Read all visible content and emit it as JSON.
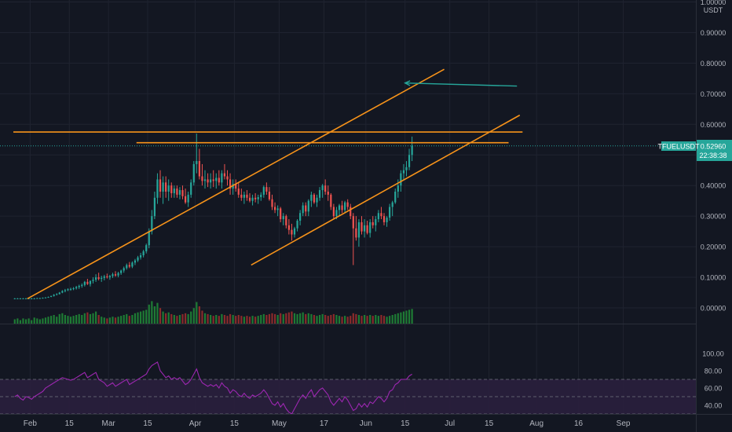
{
  "symbol": "TFUELUSDT",
  "currency": "USDT",
  "last_price": "0.52960",
  "countdown": "22:38:38",
  "colors": {
    "background": "#131722",
    "grid": "#1f2330",
    "up": "#26a69a",
    "down": "#ef5350",
    "vol_up": "#1e7b34",
    "vol_down": "#8a2b2b",
    "trendline": "#f7931a",
    "arrow": "#26a69a",
    "rsi_line": "#9c27b0",
    "rsi_band": "#2a1f3d",
    "price_badge": "#26a69a",
    "axis_text": "#b2b5be"
  },
  "price_axis": {
    "labels": [
      "1.00000",
      "0.90000",
      "0.80000",
      "0.70000",
      "0.60000",
      "0.40000",
      "0.30000",
      "0.20000",
      "0.10000",
      "0.00000"
    ]
  },
  "rsi_axis": {
    "labels": [
      "100.00",
      "80.00",
      "60.00",
      "40.00"
    ]
  },
  "time_axis": {
    "labels": [
      "Feb",
      "15",
      "Mar",
      "15",
      "Apr",
      "15",
      "May",
      "17",
      "Jun",
      "15",
      "Jul",
      "15",
      "Aug",
      "16",
      "Sep"
    ]
  },
  "chart_data": [
    {
      "type": "candlestick",
      "title": "TFUELUSDT",
      "ylabel": "USDT",
      "x_range": [
        "2021-01-26",
        "2021-09-16"
      ],
      "ylim": [
        -0.02,
        1.0
      ],
      "date_start": "2021-01-26",
      "candles": [
        [
          0.031,
          0.032,
          0.029,
          0.031
        ],
        [
          0.031,
          0.032,
          0.03,
          0.031
        ],
        [
          0.031,
          0.032,
          0.03,
          0.031
        ],
        [
          0.031,
          0.032,
          0.03,
          0.031
        ],
        [
          0.031,
          0.032,
          0.03,
          0.031
        ],
        [
          0.031,
          0.032,
          0.03,
          0.031
        ],
        [
          0.031,
          0.032,
          0.03,
          0.031
        ],
        [
          0.031,
          0.032,
          0.03,
          0.031
        ],
        [
          0.031,
          0.033,
          0.03,
          0.032
        ],
        [
          0.032,
          0.033,
          0.031,
          0.032
        ],
        [
          0.032,
          0.034,
          0.031,
          0.033
        ],
        [
          0.033,
          0.035,
          0.032,
          0.034
        ],
        [
          0.034,
          0.037,
          0.033,
          0.036
        ],
        [
          0.036,
          0.04,
          0.035,
          0.039
        ],
        [
          0.039,
          0.045,
          0.037,
          0.043
        ],
        [
          0.043,
          0.048,
          0.041,
          0.045
        ],
        [
          0.045,
          0.052,
          0.044,
          0.05
        ],
        [
          0.05,
          0.058,
          0.048,
          0.055
        ],
        [
          0.055,
          0.062,
          0.051,
          0.058
        ],
        [
          0.058,
          0.064,
          0.055,
          0.061
        ],
        [
          0.061,
          0.066,
          0.056,
          0.062
        ],
        [
          0.062,
          0.068,
          0.058,
          0.064
        ],
        [
          0.064,
          0.072,
          0.06,
          0.068
        ],
        [
          0.068,
          0.076,
          0.062,
          0.072
        ],
        [
          0.072,
          0.08,
          0.066,
          0.075
        ],
        [
          0.075,
          0.088,
          0.07,
          0.085
        ],
        [
          0.085,
          0.095,
          0.075,
          0.078
        ],
        [
          0.078,
          0.09,
          0.07,
          0.088
        ],
        [
          0.088,
          0.1,
          0.08,
          0.092
        ],
        [
          0.092,
          0.11,
          0.085,
          0.1
        ],
        [
          0.1,
          0.115,
          0.09,
          0.095
        ],
        [
          0.095,
          0.105,
          0.085,
          0.098
        ],
        [
          0.098,
          0.108,
          0.09,
          0.103
        ],
        [
          0.103,
          0.112,
          0.096,
          0.1
        ],
        [
          0.1,
          0.108,
          0.092,
          0.104
        ],
        [
          0.104,
          0.115,
          0.098,
          0.11
        ],
        [
          0.11,
          0.12,
          0.102,
          0.106
        ],
        [
          0.106,
          0.118,
          0.1,
          0.114
        ],
        [
          0.114,
          0.125,
          0.108,
          0.122
        ],
        [
          0.122,
          0.135,
          0.115,
          0.13
        ],
        [
          0.13,
          0.145,
          0.125,
          0.14
        ],
        [
          0.14,
          0.15,
          0.13,
          0.135
        ],
        [
          0.135,
          0.152,
          0.13,
          0.148
        ],
        [
          0.148,
          0.16,
          0.14,
          0.155
        ],
        [
          0.155,
          0.17,
          0.15,
          0.165
        ],
        [
          0.165,
          0.18,
          0.158,
          0.172
        ],
        [
          0.172,
          0.19,
          0.165,
          0.185
        ],
        [
          0.185,
          0.21,
          0.178,
          0.205
        ],
        [
          0.205,
          0.26,
          0.195,
          0.25
        ],
        [
          0.25,
          0.32,
          0.24,
          0.3
        ],
        [
          0.3,
          0.38,
          0.29,
          0.36
        ],
        [
          0.36,
          0.44,
          0.34,
          0.42
        ],
        [
          0.42,
          0.45,
          0.36,
          0.38
        ],
        [
          0.38,
          0.43,
          0.34,
          0.41
        ],
        [
          0.41,
          0.43,
          0.36,
          0.38
        ],
        [
          0.38,
          0.42,
          0.35,
          0.4
        ],
        [
          0.4,
          0.41,
          0.36,
          0.375
        ],
        [
          0.375,
          0.4,
          0.36,
          0.39
        ],
        [
          0.39,
          0.4,
          0.36,
          0.37
        ],
        [
          0.37,
          0.395,
          0.355,
          0.385
        ],
        [
          0.385,
          0.4,
          0.355,
          0.365
        ],
        [
          0.365,
          0.39,
          0.34,
          0.345
        ],
        [
          0.345,
          0.38,
          0.33,
          0.37
        ],
        [
          0.37,
          0.42,
          0.36,
          0.41
        ],
        [
          0.41,
          0.48,
          0.4,
          0.47
        ],
        [
          0.47,
          0.57,
          0.44,
          0.48
        ],
        [
          0.48,
          0.52,
          0.42,
          0.43
        ],
        [
          0.43,
          0.47,
          0.4,
          0.415
        ],
        [
          0.415,
          0.45,
          0.39,
          0.42
        ],
        [
          0.42,
          0.44,
          0.395,
          0.41
        ],
        [
          0.41,
          0.44,
          0.39,
          0.42
        ],
        [
          0.42,
          0.45,
          0.395,
          0.415
        ],
        [
          0.415,
          0.44,
          0.39,
          0.425
        ],
        [
          0.425,
          0.45,
          0.4,
          0.41
        ],
        [
          0.41,
          0.45,
          0.39,
          0.44
        ],
        [
          0.44,
          0.47,
          0.42,
          0.43
        ],
        [
          0.43,
          0.45,
          0.4,
          0.42
        ],
        [
          0.42,
          0.44,
          0.37,
          0.39
        ],
        [
          0.39,
          0.42,
          0.37,
          0.405
        ],
        [
          0.405,
          0.42,
          0.38,
          0.39
        ],
        [
          0.39,
          0.41,
          0.36,
          0.37
        ],
        [
          0.37,
          0.39,
          0.35,
          0.36
        ],
        [
          0.36,
          0.38,
          0.34,
          0.37
        ],
        [
          0.37,
          0.385,
          0.35,
          0.36
        ],
        [
          0.36,
          0.375,
          0.345,
          0.35
        ],
        [
          0.35,
          0.37,
          0.335,
          0.36
        ],
        [
          0.36,
          0.375,
          0.345,
          0.355
        ],
        [
          0.355,
          0.37,
          0.34,
          0.362
        ],
        [
          0.362,
          0.378,
          0.35,
          0.37
        ],
        [
          0.37,
          0.4,
          0.36,
          0.395
        ],
        [
          0.395,
          0.41,
          0.37,
          0.38
        ],
        [
          0.38,
          0.395,
          0.35,
          0.355
        ],
        [
          0.355,
          0.37,
          0.32,
          0.33
        ],
        [
          0.33,
          0.345,
          0.31,
          0.32
        ],
        [
          0.32,
          0.335,
          0.3,
          0.325
        ],
        [
          0.325,
          0.33,
          0.28,
          0.29
        ],
        [
          0.29,
          0.31,
          0.27,
          0.3
        ],
        [
          0.3,
          0.305,
          0.26,
          0.27
        ],
        [
          0.27,
          0.29,
          0.24,
          0.255
        ],
        [
          0.255,
          0.275,
          0.22,
          0.24
        ],
        [
          0.24,
          0.265,
          0.23,
          0.26
        ],
        [
          0.26,
          0.29,
          0.25,
          0.285
        ],
        [
          0.285,
          0.32,
          0.27,
          0.31
        ],
        [
          0.31,
          0.345,
          0.3,
          0.335
        ],
        [
          0.335,
          0.345,
          0.3,
          0.315
        ],
        [
          0.315,
          0.355,
          0.3,
          0.35
        ],
        [
          0.35,
          0.38,
          0.33,
          0.37
        ],
        [
          0.37,
          0.375,
          0.34,
          0.345
        ],
        [
          0.345,
          0.37,
          0.33,
          0.36
        ],
        [
          0.36,
          0.395,
          0.35,
          0.385
        ],
        [
          0.385,
          0.405,
          0.36,
          0.4
        ],
        [
          0.4,
          0.42,
          0.37,
          0.38
        ],
        [
          0.38,
          0.4,
          0.35,
          0.37
        ],
        [
          0.37,
          0.375,
          0.32,
          0.33
        ],
        [
          0.33,
          0.34,
          0.29,
          0.3
        ],
        [
          0.3,
          0.33,
          0.29,
          0.32
        ],
        [
          0.32,
          0.34,
          0.3,
          0.335
        ],
        [
          0.335,
          0.35,
          0.31,
          0.32
        ],
        [
          0.32,
          0.35,
          0.31,
          0.345
        ],
        [
          0.345,
          0.355,
          0.32,
          0.33
        ],
        [
          0.33,
          0.34,
          0.29,
          0.3
        ],
        [
          0.3,
          0.31,
          0.14,
          0.26
        ],
        [
          0.26,
          0.3,
          0.22,
          0.23
        ],
        [
          0.23,
          0.29,
          0.2,
          0.28
        ],
        [
          0.28,
          0.3,
          0.24,
          0.25
        ],
        [
          0.25,
          0.29,
          0.23,
          0.27
        ],
        [
          0.27,
          0.285,
          0.24,
          0.245
        ],
        [
          0.245,
          0.29,
          0.23,
          0.28
        ],
        [
          0.28,
          0.3,
          0.26,
          0.27
        ],
        [
          0.27,
          0.3,
          0.25,
          0.29
        ],
        [
          0.29,
          0.32,
          0.28,
          0.31
        ],
        [
          0.31,
          0.33,
          0.29,
          0.3
        ],
        [
          0.3,
          0.31,
          0.27,
          0.28
        ],
        [
          0.28,
          0.3,
          0.265,
          0.295
        ],
        [
          0.295,
          0.34,
          0.285,
          0.33
        ],
        [
          0.33,
          0.35,
          0.3,
          0.345
        ],
        [
          0.345,
          0.39,
          0.34,
          0.38
        ],
        [
          0.38,
          0.42,
          0.36,
          0.4
        ],
        [
          0.4,
          0.45,
          0.38,
          0.44
        ],
        [
          0.44,
          0.47,
          0.42,
          0.45
        ],
        [
          0.45,
          0.48,
          0.43,
          0.46
        ],
        [
          0.46,
          0.52,
          0.45,
          0.5
        ],
        [
          0.5,
          0.56,
          0.48,
          0.53
        ]
      ],
      "volume": [
        0.25,
        0.3,
        0.2,
        0.3,
        0.25,
        0.3,
        0.2,
        0.35,
        0.3,
        0.25,
        0.3,
        0.35,
        0.4,
        0.45,
        0.5,
        0.4,
        0.55,
        0.6,
        0.5,
        0.45,
        0.4,
        0.45,
        0.5,
        0.55,
        0.5,
        0.6,
        0.65,
        0.55,
        0.6,
        0.7,
        0.5,
        0.4,
        0.35,
        0.3,
        0.35,
        0.4,
        0.35,
        0.4,
        0.45,
        0.5,
        0.55,
        0.45,
        0.5,
        0.6,
        0.65,
        0.7,
        0.75,
        0.8,
        1.1,
        1.3,
        1.0,
        1.2,
        0.9,
        0.7,
        0.6,
        0.65,
        0.55,
        0.5,
        0.45,
        0.5,
        0.55,
        0.6,
        0.55,
        0.7,
        0.9,
        1.25,
        1.0,
        0.75,
        0.6,
        0.55,
        0.5,
        0.45,
        0.5,
        0.45,
        0.55,
        0.5,
        0.45,
        0.55,
        0.5,
        0.45,
        0.5,
        0.45,
        0.4,
        0.45,
        0.4,
        0.45,
        0.4,
        0.45,
        0.5,
        0.55,
        0.5,
        0.55,
        0.6,
        0.55,
        0.5,
        0.6,
        0.55,
        0.6,
        0.65,
        0.7,
        0.6,
        0.55,
        0.6,
        0.65,
        0.55,
        0.6,
        0.55,
        0.5,
        0.45,
        0.5,
        0.55,
        0.5,
        0.45,
        0.5,
        0.55,
        0.5,
        0.45,
        0.4,
        0.45,
        0.4,
        0.45,
        0.6,
        0.55,
        0.5,
        0.45,
        0.5,
        0.45,
        0.5,
        0.45,
        0.5,
        0.45,
        0.5,
        0.45,
        0.4,
        0.45,
        0.5,
        0.55,
        0.6,
        0.65,
        0.7,
        0.75,
        0.8,
        0.85
      ],
      "trendlines": [
        {
          "name": "channel-upper",
          "points": [
            [
              "2021-01-31",
              0.03
            ],
            [
              "2021-06-29",
              0.78
            ]
          ]
        },
        {
          "name": "channel-lower",
          "points": [
            [
              "2021-04-21",
              0.14
            ],
            [
              "2021-07-26",
              0.63
            ]
          ]
        },
        {
          "name": "resistance-1",
          "points": [
            [
              "2021-01-26",
              0.575
            ],
            [
              "2021-07-27",
              0.575
            ]
          ]
        },
        {
          "name": "resistance-2",
          "points": [
            [
              "2021-03-11",
              0.54
            ],
            [
              "2021-07-22",
              0.54
            ]
          ]
        }
      ],
      "arrow": {
        "from": [
          "2021-07-25",
          0.725
        ],
        "to": [
          "2021-06-15",
          0.735
        ]
      },
      "current_price": 0.5296
    },
    {
      "type": "line",
      "title": "",
      "ylim": [
        20,
        100
      ],
      "bands": [
        30,
        50,
        70
      ],
      "rsi": [
        50,
        52,
        48,
        46,
        50,
        49,
        47,
        50,
        52,
        54,
        56,
        60,
        62,
        64,
        66,
        68,
        70,
        72,
        71,
        70,
        69,
        70,
        72,
        74,
        76,
        78,
        72,
        74,
        76,
        78,
        70,
        68,
        66,
        62,
        64,
        66,
        62,
        64,
        66,
        68,
        70,
        64,
        66,
        68,
        70,
        72,
        74,
        76,
        82,
        86,
        88,
        90,
        80,
        76,
        72,
        74,
        70,
        72,
        70,
        72,
        68,
        64,
        66,
        70,
        76,
        82,
        72,
        66,
        64,
        62,
        64,
        62,
        64,
        60,
        66,
        62,
        60,
        54,
        58,
        56,
        52,
        50,
        54,
        50,
        48,
        52,
        50,
        52,
        54,
        58,
        54,
        48,
        42,
        40,
        44,
        38,
        42,
        36,
        32,
        30,
        36,
        42,
        48,
        52,
        48,
        54,
        58,
        50,
        54,
        58,
        60,
        56,
        52,
        44,
        40,
        44,
        48,
        44,
        50,
        46,
        40,
        34,
        36,
        42,
        38,
        42,
        38,
        44,
        42,
        46,
        50,
        48,
        44,
        48,
        56,
        58,
        64,
        66,
        70,
        70,
        70,
        74,
        76
      ]
    }
  ]
}
